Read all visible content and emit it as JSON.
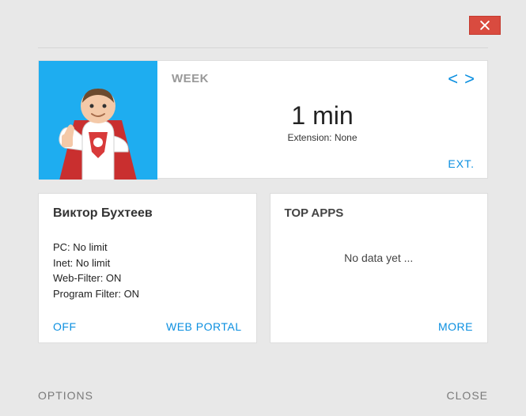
{
  "window": {
    "close_icon": "close"
  },
  "top": {
    "period_label": "WEEK",
    "prev_glyph": "<",
    "next_glyph": ">",
    "time_value": "1 min",
    "extension_label": "Extension: None",
    "ext_link": "EXT."
  },
  "user_card": {
    "name": "Виктор Бухтеев",
    "limits": {
      "pc": "PC: No limit",
      "inet": "Inet: No limit",
      "webfilter": "Web-Filter: ON",
      "progfilter": "Program Filter: ON"
    },
    "off_link": "OFF",
    "portal_link": "WEB PORTAL"
  },
  "topapps": {
    "title": "TOP APPS",
    "empty": "No data yet ...",
    "more_link": "MORE"
  },
  "footer": {
    "options": "OPTIONS",
    "close": "CLOSE"
  },
  "colors": {
    "accent": "#0b8fe0",
    "close_bg": "#d94b3f",
    "avatar_bg": "#1eadf0"
  }
}
